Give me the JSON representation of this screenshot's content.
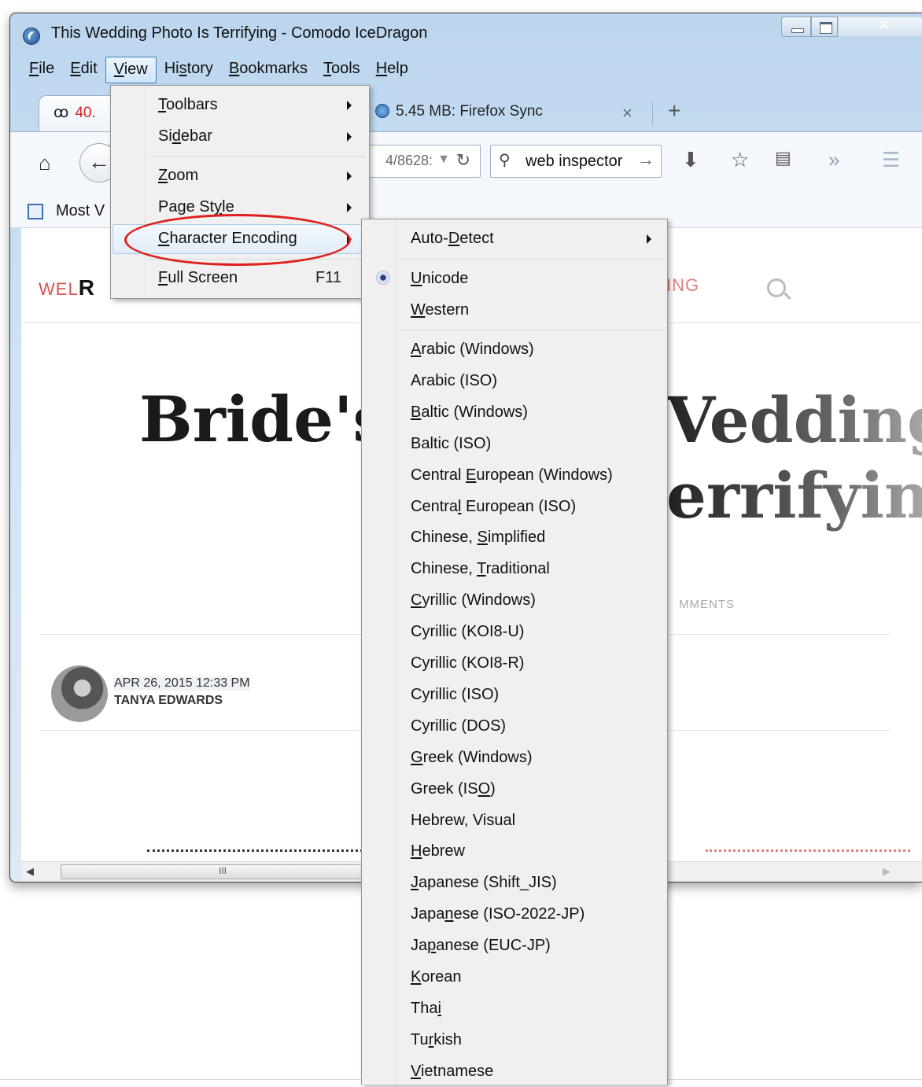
{
  "window": {
    "title": "This Wedding Photo Is Terrifying - Comodo IceDragon",
    "close_glyph": "✕"
  },
  "menubar": {
    "items": [
      {
        "pre": "",
        "acc": "F",
        "post": "ile"
      },
      {
        "pre": "",
        "acc": "E",
        "post": "dit"
      },
      {
        "pre": "",
        "acc": "V",
        "post": "iew"
      },
      {
        "pre": "Hi",
        "acc": "s",
        "post": "tory"
      },
      {
        "pre": "",
        "acc": "B",
        "post": "ookmarks"
      },
      {
        "pre": "",
        "acc": "T",
        "post": "ools"
      },
      {
        "pre": "",
        "acc": "H",
        "post": "elp"
      }
    ]
  },
  "tabs": {
    "active_icon": "ꝏ",
    "active_count": "40.",
    "inactive_title": "5.45 MB: Firefox Sync",
    "close_glyph": "×",
    "new_tab_glyph": "+"
  },
  "navbar": {
    "url_fragment": "4/8628:",
    "search_value": "web inspector",
    "home_icon": "home-icon",
    "download_icon": "download-icon",
    "bookmark_star_icon": "star-icon",
    "bookmarks_menu_icon": "bookmarks-menu-icon",
    "overflow_label": "»",
    "hamburger_label": "☰"
  },
  "bookmarks_bar": {
    "most_visited_label": "Most V"
  },
  "page": {
    "nav_left_prefix": "WEL",
    "nav_left_bold": "R",
    "nav_right": "ING",
    "headline_left": "Bride's",
    "headline_right_line1": "Vedding",
    "headline_right_line2": "errifyin",
    "comments_fragment": "MMENTS",
    "post_date": "APR 26, 2015 12:33 PM",
    "post_author": "TANYA EDWARDS"
  },
  "scrollbar": {
    "grip": "III"
  },
  "view_menu": {
    "items": [
      {
        "pre": "",
        "acc": "T",
        "post": "oolbars",
        "submenu": true
      },
      {
        "pre": "Si",
        "acc": "d",
        "post": "ebar",
        "submenu": true
      },
      {
        "pre": "",
        "acc": "Z",
        "post": "oom",
        "submenu": true
      },
      {
        "pre": "Page St",
        "acc": "y",
        "post": "le",
        "submenu": true
      },
      {
        "pre": "",
        "acc": "C",
        "post": "haracter Encoding",
        "submenu": true,
        "highlighted": true
      },
      {
        "pre": "",
        "acc": "F",
        "post": "ull Screen",
        "accel": "F11"
      }
    ]
  },
  "encoding_menu": {
    "auto_detect": {
      "pre": "Auto-",
      "acc": "D",
      "post": "etect"
    },
    "unicode": {
      "pre": "",
      "acc": "U",
      "post": "nicode",
      "checked": true
    },
    "western": {
      "pre": "",
      "acc": "W",
      "post": "estern"
    },
    "encodings": [
      {
        "pre": "",
        "acc": "A",
        "post": "rabic (Windows)"
      },
      {
        "pre": "Arabic (ISO)",
        "acc": "",
        "post": ""
      },
      {
        "pre": "",
        "acc": "B",
        "post": "altic (Windows)"
      },
      {
        "pre": "Baltic (ISO)",
        "acc": "",
        "post": ""
      },
      {
        "pre": "Central ",
        "acc": "E",
        "post": "uropean (Windows)"
      },
      {
        "pre": "Centra",
        "acc": "l",
        "post": " European (ISO)"
      },
      {
        "pre": "Chinese, ",
        "acc": "S",
        "post": "implified"
      },
      {
        "pre": "Chinese, ",
        "acc": "T",
        "post": "raditional"
      },
      {
        "pre": "",
        "acc": "C",
        "post": "yrillic (Windows)"
      },
      {
        "pre": "Cyrillic (KOI8-U)",
        "acc": "",
        "post": ""
      },
      {
        "pre": "Cyrillic (KOI8-R)",
        "acc": "",
        "post": ""
      },
      {
        "pre": "Cyrillic (ISO)",
        "acc": "",
        "post": ""
      },
      {
        "pre": "Cyrillic (DOS)",
        "acc": "",
        "post": ""
      },
      {
        "pre": "",
        "acc": "G",
        "post": "reek (Windows)"
      },
      {
        "pre": "Greek (IS",
        "acc": "O",
        "post": ")"
      },
      {
        "pre": "Hebrew, Visual",
        "acc": "",
        "post": ""
      },
      {
        "pre": "",
        "acc": "H",
        "post": "ebrew"
      },
      {
        "pre": "",
        "acc": "J",
        "post": "apanese (Shift_JIS)"
      },
      {
        "pre": "Japa",
        "acc": "n",
        "post": "ese (ISO-2022-JP)"
      },
      {
        "pre": "Ja",
        "acc": "p",
        "post": "anese (EUC-JP)"
      },
      {
        "pre": "",
        "acc": "K",
        "post": "orean"
      },
      {
        "pre": "Tha",
        "acc": "i",
        "post": ""
      },
      {
        "pre": "Tu",
        "acc": "r",
        "post": "kish"
      },
      {
        "pre": "",
        "acc": "V",
        "post": "ietnamese"
      }
    ]
  },
  "colors": {
    "annotation": "#e0201c",
    "site_accent": "#d9534f",
    "tab_count": "#d62020"
  }
}
